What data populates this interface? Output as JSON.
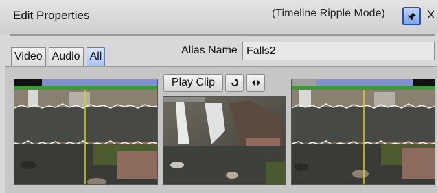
{
  "window": {
    "title": "Edit Properties",
    "mode": "(Timeline Ripple Mode)",
    "close_label": "X"
  },
  "tabs": [
    {
      "label": "Video",
      "active": false
    },
    {
      "label": "Audio",
      "active": false
    },
    {
      "label": "All",
      "active": true
    }
  ],
  "alias": {
    "label": "Alias Name",
    "value": "Falls2"
  },
  "controls": {
    "play_clip_label": "Play Clip",
    "loop_icon": "loop-icon",
    "trim_icon": "trim-arrows-icon"
  },
  "frames": [
    {
      "name": "in-point-frame",
      "type": "video-with-waveform"
    },
    {
      "name": "preview-frame",
      "type": "video"
    },
    {
      "name": "out-point-frame",
      "type": "video-with-waveform"
    }
  ],
  "colors": {
    "accent_blue": "#7f8fd6",
    "accent_green": "#3a9a3a",
    "playhead": "#d4d02a",
    "pin_border": "#2d4f9e"
  }
}
